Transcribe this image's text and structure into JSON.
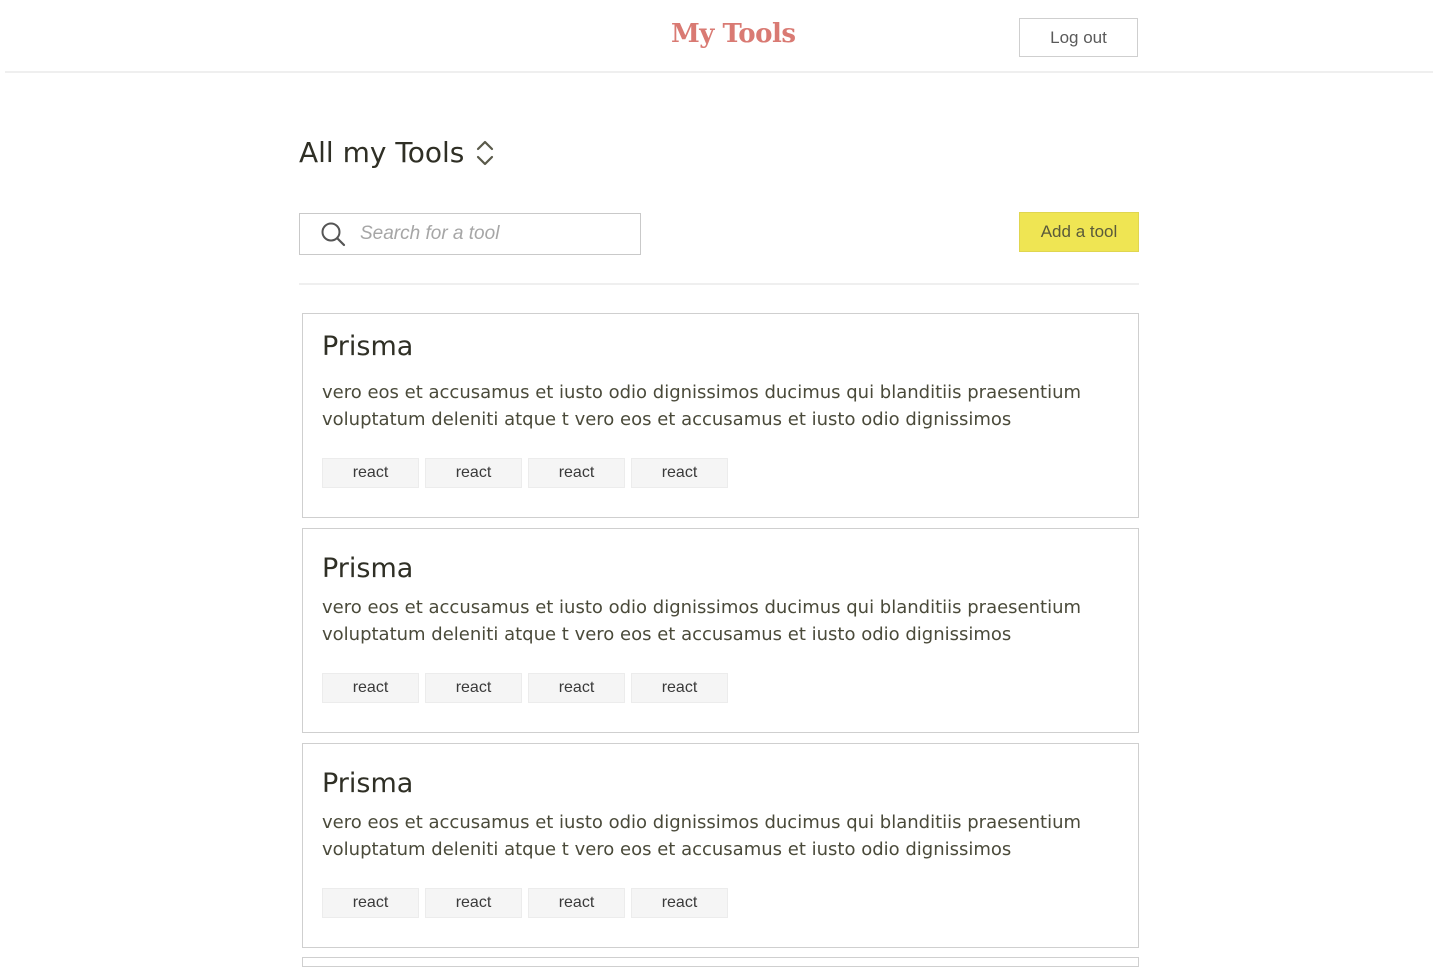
{
  "header": {
    "brand": "My Tools",
    "logout_label": "Log out"
  },
  "main": {
    "title": "All my Tools",
    "search_placeholder": "Search for a tool",
    "add_label": "Add a tool",
    "tools": [
      {
        "name": "Prisma",
        "description": "vero eos et accusamus et iusto odio dignissimos ducimus qui blanditiis praesentium voluptatum deleniti atque t vero eos et accusamus et iusto odio dignissimos",
        "tags": [
          "react",
          "react",
          "react",
          "react"
        ]
      },
      {
        "name": "Prisma",
        "description": "vero eos et accusamus et iusto odio dignissimos ducimus qui blanditiis praesentium voluptatum deleniti atque t vero eos et accusamus et iusto odio dignissimos",
        "tags": [
          "react",
          "react",
          "react",
          "react"
        ]
      },
      {
        "name": "Prisma",
        "description": "vero eos et accusamus et iusto odio dignissimos ducimus qui blanditiis praesentium voluptatum deleniti atque t vero eos et accusamus et iusto odio dignissimos",
        "tags": [
          "react",
          "react",
          "react",
          "react"
        ]
      }
    ]
  },
  "icons": {
    "sort": "sort-updown-icon",
    "search": "search-icon"
  },
  "colors": {
    "brand": "#d97a73",
    "accent_button": "#efe553",
    "text": "#2f2f25"
  }
}
